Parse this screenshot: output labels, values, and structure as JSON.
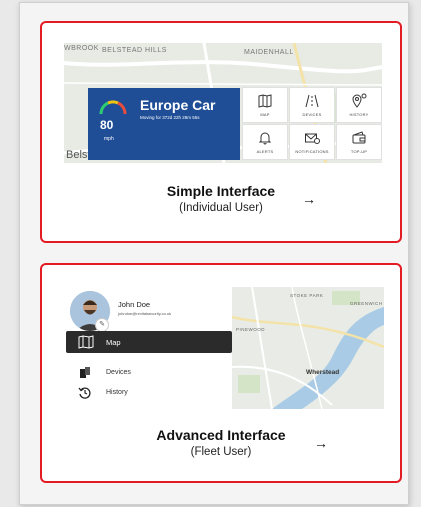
{
  "simple": {
    "title": "Simple Interface",
    "subtitle": "(Individual User)",
    "arrow": "→",
    "map_labels": {
      "belstead_hills": "BELSTEAD HILLS",
      "maidenhall": "MAIDENHALL",
      "westbrook": "WBROOK",
      "belstead": "Belstead"
    },
    "car": {
      "name": "Europe Car",
      "status": "Moving for 372d 22h 28m 55s",
      "speed": "80",
      "speed_unit": "mph"
    },
    "tiles": [
      {
        "label": "MAP",
        "icon": "map-icon"
      },
      {
        "label": "DEVICES",
        "icon": "road-icon"
      },
      {
        "label": "HISTORY",
        "icon": "location-history-icon"
      },
      {
        "label": "ALERTS",
        "icon": "bell-icon"
      },
      {
        "label": "NOTIFICATIONS",
        "icon": "envelope-alert-icon"
      },
      {
        "label": "TOP-UP",
        "icon": "wallet-icon"
      }
    ]
  },
  "advanced": {
    "title": "Advanced Interface",
    "subtitle": "(Fleet User)",
    "arrow": "→",
    "user": {
      "name": "John Doe",
      "email": "johndoe@revitalsecurity.co.uk"
    },
    "nav": [
      {
        "label": "Map",
        "icon": "map-icon",
        "active": true
      },
      {
        "label": "Devices",
        "icon": "devices-icon",
        "active": false
      },
      {
        "label": "History",
        "icon": "history-icon",
        "active": false
      }
    ],
    "map_labels": {
      "stoke_park": "STOKE PARK",
      "greenwich": "GREENWICH",
      "wherstead": "Wherstead",
      "pinewood": "PINEWOOD"
    }
  },
  "colors": {
    "accent_red": "#e31b23",
    "car_blue": "#1f4e97",
    "nav_dark": "#2b2b2b",
    "water": "#a9cbe6"
  }
}
